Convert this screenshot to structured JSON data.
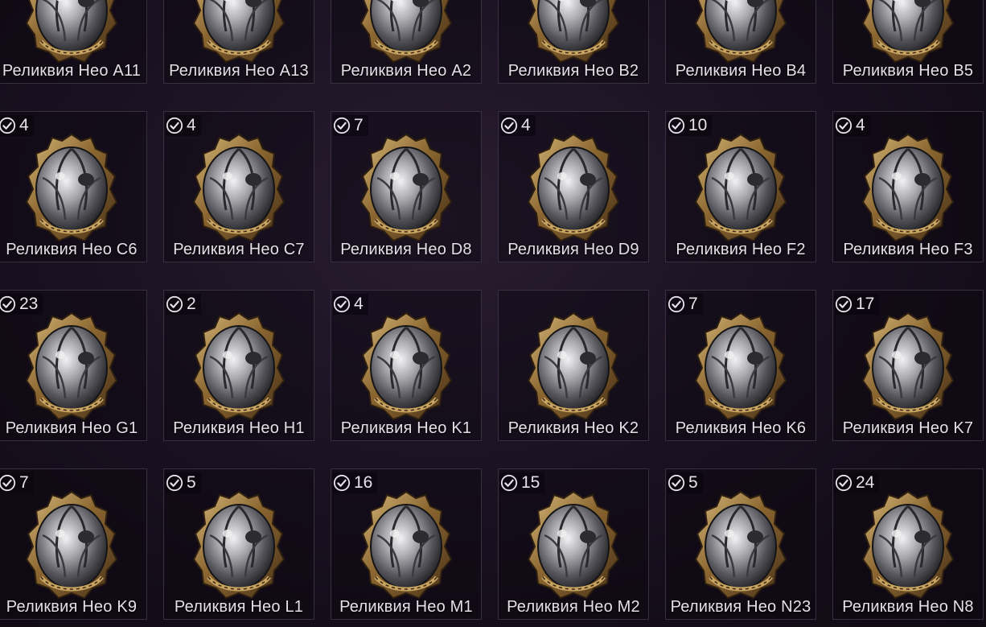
{
  "relics": [
    {
      "name": "Реликвия Нео A11",
      "count": ""
    },
    {
      "name": "Реликвия Нео A13",
      "count": ""
    },
    {
      "name": "Реликвия Нео A2",
      "count": ""
    },
    {
      "name": "Реликвия Нео B2",
      "count": ""
    },
    {
      "name": "Реликвия Нео B4",
      "count": ""
    },
    {
      "name": "Реликвия Нео B5",
      "count": ""
    },
    {
      "name": "Реликвия Нео C6",
      "count": "4"
    },
    {
      "name": "Реликвия Нео C7",
      "count": "4"
    },
    {
      "name": "Реликвия Нео D8",
      "count": "7"
    },
    {
      "name": "Реликвия Нео D9",
      "count": "4"
    },
    {
      "name": "Реликвия Нео F2",
      "count": "10"
    },
    {
      "name": "Реликвия Нео F3",
      "count": "4"
    },
    {
      "name": "Реликвия Нео G1",
      "count": "23"
    },
    {
      "name": "Реликвия Нео H1",
      "count": "2"
    },
    {
      "name": "Реликвия Нео K1",
      "count": "4"
    },
    {
      "name": "Реликвия Нео K2",
      "count": ""
    },
    {
      "name": "Реликвия Нео K6",
      "count": "7"
    },
    {
      "name": "Реликвия Нео K7",
      "count": "17"
    },
    {
      "name": "Реликвия Нео K9",
      "count": "7"
    },
    {
      "name": "Реликвия Нео L1",
      "count": "5"
    },
    {
      "name": "Реликвия Нео M1",
      "count": "16"
    },
    {
      "name": "Реликвия Нео M2",
      "count": "15"
    },
    {
      "name": "Реликвия Нео N23",
      "count": "5"
    },
    {
      "name": "Реликвия Нео N8",
      "count": "24"
    }
  ],
  "icons": {
    "count_badge": "check-circle-icon",
    "item_image": "neo-relic-icon"
  },
  "colors": {
    "background": "#1c1323",
    "card_border": "#3a2f40",
    "label_text": "#e4e0e8",
    "relic_gold": "#a8834a",
    "relic_silver": "#c9c9cc"
  }
}
